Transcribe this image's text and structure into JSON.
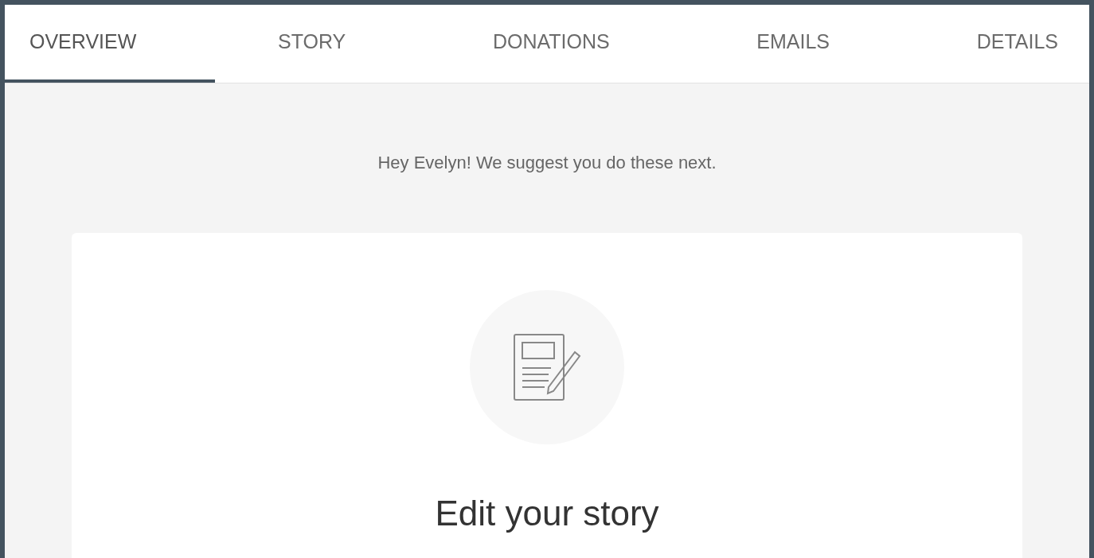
{
  "tabs": [
    {
      "label": "OVERVIEW",
      "selected": true
    },
    {
      "label": "STORY",
      "selected": false
    },
    {
      "label": "DONATIONS",
      "selected": false
    },
    {
      "label": "EMAILS",
      "selected": false
    },
    {
      "label": "DETAILS",
      "selected": false
    }
  ],
  "greeting": "Hey Evelyn! We suggest you do these next.",
  "card": {
    "title": "Edit your story"
  }
}
